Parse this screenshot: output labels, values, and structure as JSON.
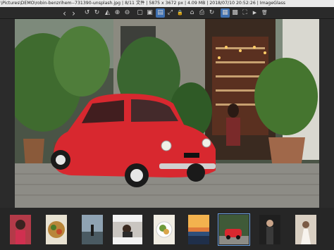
{
  "window": {
    "title": "\\Pictures\\DEMO\\robin-benzrihem--731390-unsplash.jpg  |  8/11 文件  |  5875 x 3672 px  |  4.09 MB  |  2018/07/10 20:52:26  |  ImageGlass"
  },
  "toolbar": {
    "buttons": [
      {
        "name": "previous-image-button",
        "icon": "chevron-left-icon",
        "glyph": "‹"
      },
      {
        "name": "next-image-button",
        "icon": "chevron-right-icon",
        "glyph": "›"
      },
      {
        "name": "rotate-left-button",
        "icon": "rotate-left-icon",
        "glyph": "↺"
      },
      {
        "name": "rotate-right-button",
        "icon": "rotate-right-icon",
        "glyph": "↻"
      },
      {
        "name": "flip-horizontal-button",
        "icon": "flip-icon",
        "glyph": "◭"
      },
      {
        "name": "zoom-in-button",
        "icon": "zoom-in-icon",
        "glyph": "⊕"
      },
      {
        "name": "zoom-out-button",
        "icon": "zoom-out-icon",
        "glyph": "⊖"
      },
      {
        "name": "actual-size-button",
        "icon": "actual-size-icon",
        "glyph": "▢"
      },
      {
        "name": "scale-to-fit-button",
        "icon": "fit-icon",
        "glyph": "▣"
      },
      {
        "name": "scale-to-width-button",
        "icon": "fit-width-icon",
        "glyph": "▤"
      },
      {
        "name": "auto-zoom-button",
        "icon": "auto-zoom-icon",
        "glyph": "⤢"
      },
      {
        "name": "lock-zoom-button",
        "icon": "lock-icon",
        "glyph": "🔒"
      },
      {
        "name": "open-file-button",
        "icon": "open-icon",
        "glyph": "⌂"
      },
      {
        "name": "save-button",
        "icon": "save-icon",
        "glyph": "⎙"
      },
      {
        "name": "refresh-button",
        "icon": "refresh-icon",
        "glyph": "↻"
      },
      {
        "name": "thumbnail-bar-button",
        "icon": "thumbnail-icon",
        "glyph": "▦"
      },
      {
        "name": "checkerboard-button",
        "icon": "checkerboard-icon",
        "glyph": "▩"
      },
      {
        "name": "fullscreen-button",
        "icon": "fullscreen-icon",
        "glyph": "⛶"
      },
      {
        "name": "slideshow-button",
        "icon": "slideshow-icon",
        "glyph": "▶"
      },
      {
        "name": "delete-button",
        "icon": "trash-icon",
        "glyph": "🗑"
      }
    ]
  },
  "thumbnails": [
    {
      "name": "thumbnail-1",
      "subject": "woman in red"
    },
    {
      "name": "thumbnail-2",
      "subject": "food bowl"
    },
    {
      "name": "thumbnail-3",
      "subject": "person at lake"
    },
    {
      "name": "thumbnail-4",
      "subject": "portrait"
    },
    {
      "name": "thumbnail-5",
      "subject": "plate of food"
    },
    {
      "name": "thumbnail-6",
      "subject": "sunset beach"
    },
    {
      "name": "thumbnail-7",
      "subject": "red car",
      "selected": true
    },
    {
      "name": "thumbnail-8",
      "subject": "woman in dark"
    },
    {
      "name": "thumbnail-9",
      "subject": "bride"
    }
  ],
  "colors": {
    "accent": "#3d6fb0",
    "selection": "#6aa0e0",
    "toolbar_bg": "#2a2a2a",
    "viewer_bg": "#2b2b2b"
  }
}
